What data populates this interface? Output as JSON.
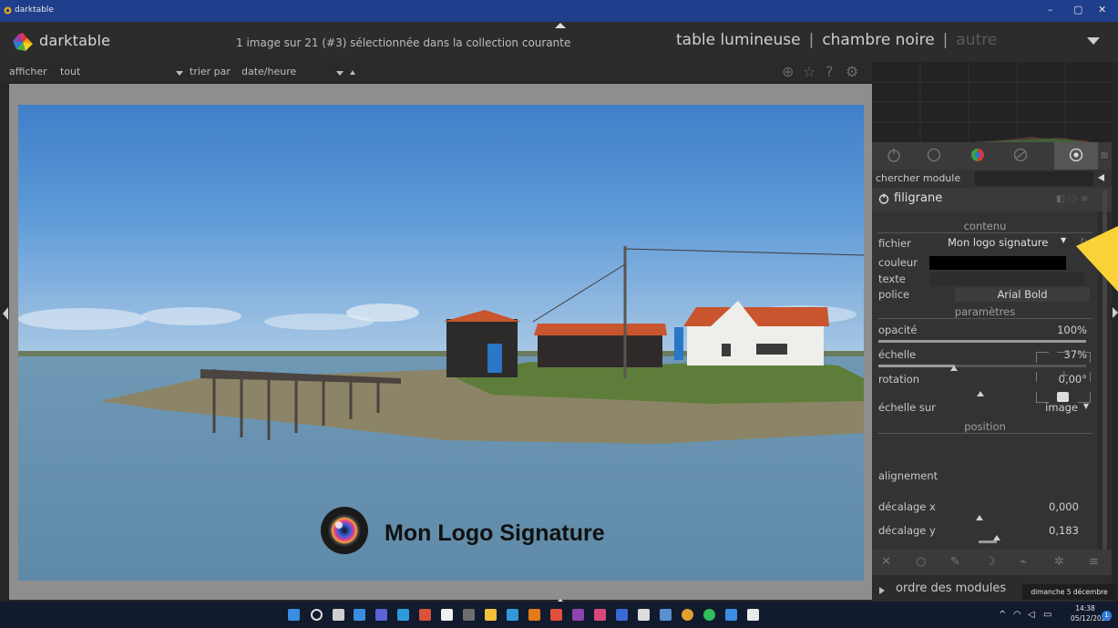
{
  "window": {
    "title": "darktable",
    "controls": {
      "minimize": "–",
      "maximize": "▢",
      "close": "✕"
    }
  },
  "header": {
    "app_name": "darktable",
    "collection_info": "1 image sur 21 (#3) sélectionnée dans la collection courante",
    "views": {
      "lighttable": "table lumineuse",
      "separator": "|",
      "darkroom": "chambre noire",
      "other": "autre"
    }
  },
  "filterbar": {
    "show_label": "afficher",
    "show_value": "tout",
    "sort_label": "trier par",
    "sort_value": "date/heure",
    "icons": [
      "grouping-icon",
      "star-icon",
      "help-icon",
      "settings-icon"
    ]
  },
  "image": {
    "watermark_text": "Mon Logo Signature"
  },
  "right_panel": {
    "module_tabs": [
      "power-icon",
      "circle-icon",
      "color-wheel-icon",
      "correct-icon",
      "effects-icon",
      "menu-icon"
    ],
    "active_tab_index": 4,
    "search_label": "chercher module",
    "module": {
      "title": "filigrane",
      "sections": {
        "content": "contenu",
        "parameters": "paramètres",
        "position": "position"
      },
      "file_label": "fichier",
      "file_value": "Mon logo signature",
      "color_label": "couleur",
      "color_value": "#000000",
      "text_label": "texte",
      "text_value": "",
      "font_label": "police",
      "font_value": "Arial Bold",
      "opacity_label": "opacité",
      "opacity_value": "100%",
      "opacity_level": 1.0,
      "scale_label": "échelle",
      "scale_value": "37%",
      "scale_level": 0.37,
      "rotation_label": "rotation",
      "rotation_value": "0,00°",
      "scale_on_label": "échelle sur",
      "scale_on_value": "image",
      "alignment_label": "alignement",
      "alignment_value": "bottom-center",
      "offset_x_label": "décalage x",
      "offset_x_value": "0,000",
      "offset_y_label": "décalage y",
      "offset_y_value": "0,183",
      "offset_y_level": 0.183
    },
    "modules_order_label": "ordre des modules"
  },
  "tooltip": {
    "date": "dimanche 5 décembre 2021"
  },
  "taskbar": {
    "time": "14:38",
    "date": "05/12/2021",
    "notifications": "1",
    "tray_icons": [
      "chevron-up-icon",
      "wifi-icon",
      "volume-icon",
      "battery-icon"
    ]
  },
  "colors": {
    "titlebar": "#1f3e8c",
    "panel": "#2c2c2c",
    "center_background": "#8e8e8e",
    "taskbar": "#121a2e",
    "pointer": "#f8d237"
  }
}
